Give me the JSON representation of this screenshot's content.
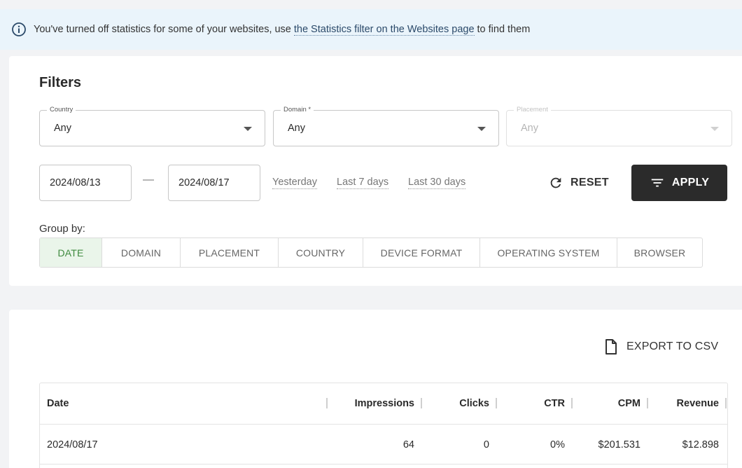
{
  "info_bar": {
    "prefix": "You've turned off statistics for some of your websites, use",
    "link_text": "the Statistics filter on the Websites page",
    "suffix": "to find them"
  },
  "filters": {
    "title": "Filters",
    "country": {
      "label": "Country",
      "value": "Any"
    },
    "domain": {
      "label": "Domain *",
      "value": "Any"
    },
    "placement": {
      "label": "Placement",
      "value": "Any"
    },
    "date_from": "2024/08/13",
    "date_separator": "—",
    "date_to": "2024/08/17",
    "quick_ranges": [
      "Yesterday",
      "Last 7 days",
      "Last 30 days"
    ],
    "reset_label": "RESET",
    "apply_label": "APPLY",
    "group_by_label": "Group by:",
    "group_options": [
      "DATE",
      "DOMAIN",
      "PLACEMENT",
      "COUNTRY",
      "DEVICE FORMAT",
      "OPERATING SYSTEM",
      "BROWSER"
    ],
    "group_active": "DATE"
  },
  "results": {
    "export_label": "EXPORT TO CSV",
    "columns": [
      "Date",
      "Impressions",
      "Clicks",
      "CTR",
      "CPM",
      "Revenue"
    ],
    "rows": [
      [
        "2024/08/17",
        "64",
        "0",
        "0%",
        "$201.531",
        "$12.898"
      ]
    ]
  },
  "colors": {
    "info_bg": "#eaf4fb",
    "primary_button": "#2b2b2b",
    "active_group_bg": "#eaf5ea",
    "active_group_text": "#3f8a3f"
  }
}
